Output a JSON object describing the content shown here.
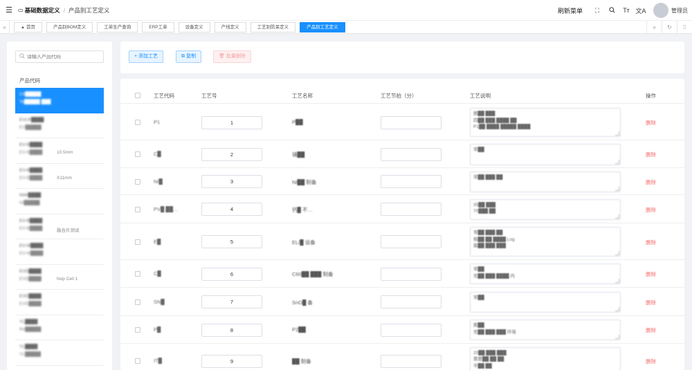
{
  "header": {
    "breadcrumb": [
      "基础数据定义",
      "产品别工艺定义"
    ],
    "refresh_menu": "刷新菜单",
    "username": "管理员",
    "tools": [
      "fullscreen-icon",
      "search-icon",
      "font-size-icon",
      "translate-icon"
    ]
  },
  "tabs": [
    {
      "label": "首页"
    },
    {
      "label": "产品别BOM定义"
    },
    {
      "label": "工单生产查询"
    },
    {
      "label": "ERP工单"
    },
    {
      "label": "设备定义"
    },
    {
      "label": "产线定义"
    },
    {
      "label": "工艺别防呆定义"
    },
    {
      "label": "产品别工艺定义",
      "active": true
    }
  ],
  "left_panel": {
    "search_placeholder": "请输入产品代码",
    "section_label": "产品代码",
    "items": [
      {
        "code": "C6█████",
        "name": "Te█████ ███",
        "extra": ""
      },
      {
        "code": "EVLR████",
        "name": "EV█████",
        "extra": ""
      },
      {
        "code": "EV-B████",
        "name": "EV-B████",
        "extra": "10.5mm"
      },
      {
        "code": "EV-B████",
        "name": "EV-B████",
        "extra": "X11mm"
      },
      {
        "code": "NIW████",
        "name": "NI█████",
        "extra": ""
      },
      {
        "code": "EV-B████",
        "name": "EV-B████",
        "extra": "融合片测试"
      },
      {
        "code": "EV-M████",
        "name": "EV-M████",
        "extra": ""
      },
      {
        "code": "EVD████",
        "name": "EVD████",
        "extra": "Nop Cell 1"
      },
      {
        "code": "EVD████",
        "name": "EVD████",
        "extra": ""
      },
      {
        "code": "YL████",
        "name": "Re█████",
        "extra": ""
      },
      {
        "code": "YL████",
        "name": "YL█████",
        "extra": ""
      }
    ]
  },
  "toolbar": {
    "add_label": "+ 添加工艺",
    "copy_label": "复制",
    "batch_delete_label": "批量删除"
  },
  "table": {
    "headers": [
      "工艺代码",
      "工艺号",
      "工艺名称",
      "工艺节拍（分）",
      "工艺说明",
      "操作"
    ],
    "action_label": "删除",
    "rows": [
      {
        "code": "P1",
        "no": "1",
        "name": "P██",
        "desc": "图██ ███\n四██ ███ ████ ██\nP1██ ████ █████ ████"
      },
      {
        "code": "C█",
        "no": "2",
        "name": "铺██",
        "desc": "常██"
      },
      {
        "code": "NI█",
        "no": "3",
        "name": "NI██ 制备",
        "desc": "常██ ███ ██"
      },
      {
        "code": "PV█ ██…",
        "no": "4",
        "name": "钙█ 不…",
        "desc": "35██ ███\n70███ ██"
      },
      {
        "code": "E█",
        "no": "5",
        "name": "EL/█ 设备",
        "desc": "常██ ███ ██\n根██ ██ ████ Log\n面██ ███ ███"
      },
      {
        "code": "C█",
        "no": "6",
        "name": "C60██ ███ 制备",
        "desc": "常██\n完██ ███ ████ 内"
      },
      {
        "code": "SN█",
        "no": "7",
        "name": "SnO█ 备",
        "desc": "常██"
      },
      {
        "code": "P█",
        "no": "8",
        "name": "P2██",
        "desc": "图██\n完██ ███ ███ 环境"
      },
      {
        "code": "IT█",
        "no": "9",
        "name": "██ 制备",
        "desc": "20██ ███ ███\n需要██ ██ ██\n平██ ██"
      }
    ]
  }
}
